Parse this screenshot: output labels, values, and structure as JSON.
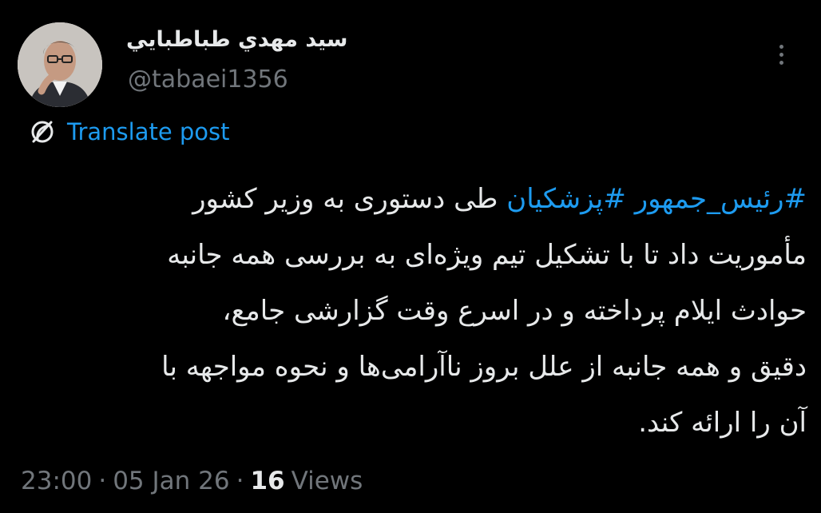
{
  "author": {
    "display_name": "سيد مهدي طباطبايي",
    "handle": "@tabaei1356"
  },
  "translate_label": "Translate post",
  "post": {
    "line1_hashtag1": "#رئیس_جمهور",
    "line1_hashtag2": "#پزشکیان",
    "line1_text": "طی دستوری به وزیر کشور",
    "line2": "مأموریت داد تا با تشکیل تیم ویژه‌ای به بررسی همه جانبه",
    "line3": "حوادث ایلام پرداخته و در اسرع وقت گزارشی جامع،",
    "line4": "دقیق و همه جانبه از علل بروز ناآرامی‌ها و نحوه مواجهه با",
    "line5": "آن را ارائه کند."
  },
  "meta": {
    "time": "23:00",
    "separator": "·",
    "date": "05 Jan 26",
    "views_count": "16",
    "views_label": "Views"
  },
  "colors": {
    "background": "#000000",
    "text": "#e7e9ea",
    "muted": "#71767b",
    "link": "#1d9bf0"
  },
  "icons": {
    "more": "more-vertical-icon",
    "translate": "translate-globe-icon"
  }
}
